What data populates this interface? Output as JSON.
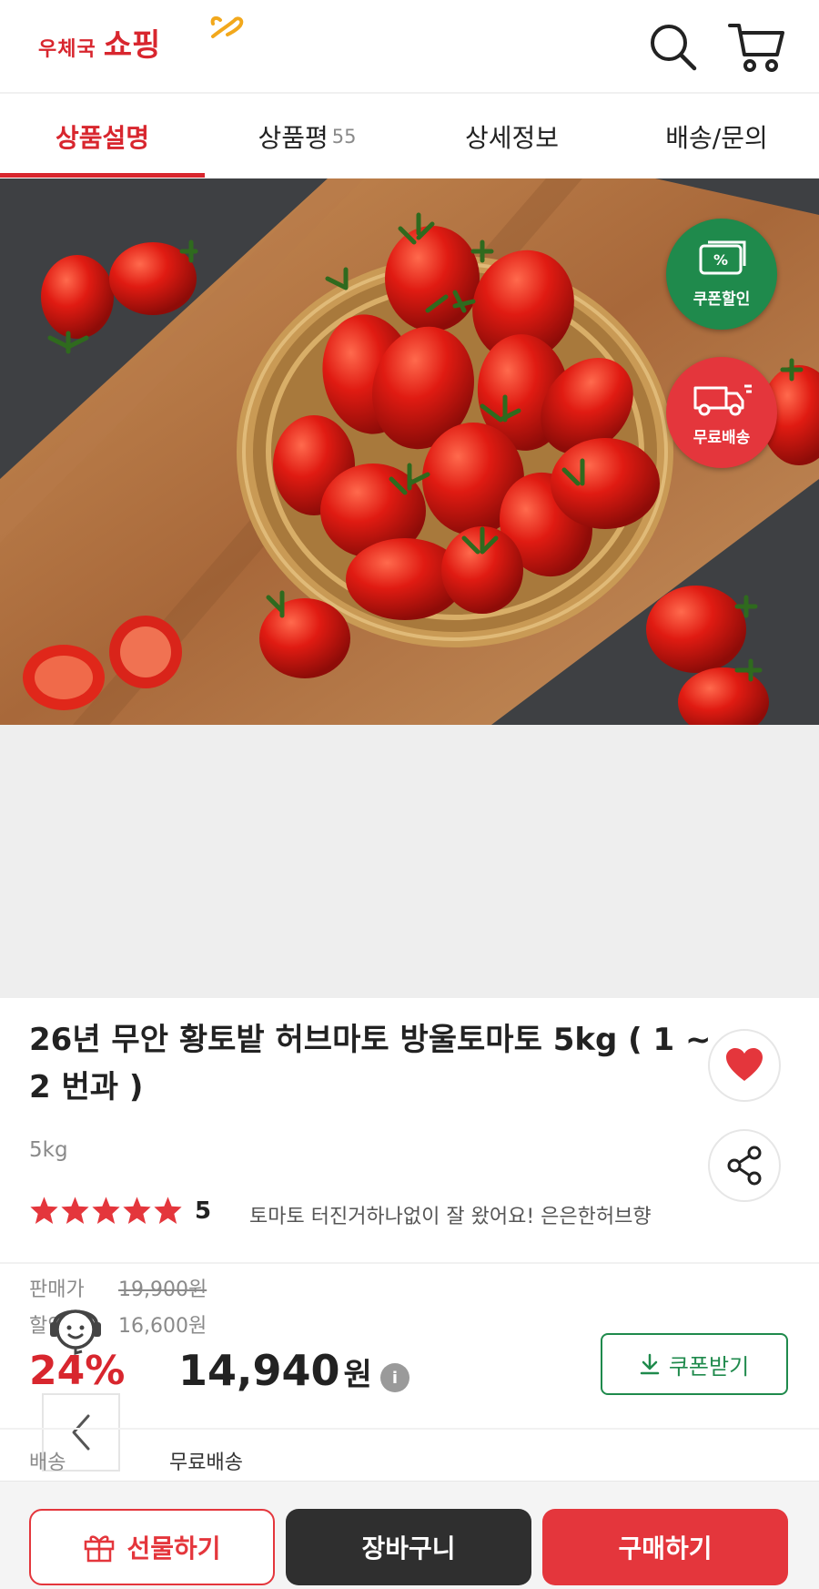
{
  "header": {
    "logo_small": "우체국",
    "logo_big": "쇼핑",
    "icons": [
      "search-icon",
      "cart-icon"
    ]
  },
  "tabs": [
    {
      "label": "상품설명",
      "active": true
    },
    {
      "label": "상품평",
      "count": "55"
    },
    {
      "label": "상세정보"
    },
    {
      "label": "배송/문의"
    }
  ],
  "badges": {
    "coupon": "쿠폰할인",
    "coupon_symbol": "%",
    "shipping": "무료배송"
  },
  "product": {
    "title": "26년 무안 황토밭 허브마토 방울토마토 5kg ( 1 ~ 2 번과 )",
    "option": "5kg",
    "rating": "5",
    "stars_filled": 5,
    "review_snippet": "토마토 터진거하나없이 잘 왔어요! 은은한허브향"
  },
  "price": {
    "original_label": "판매가",
    "original": "19,900원",
    "discount_label": "할인가",
    "discounted": "16,600원",
    "rate": "24%",
    "final": "14,940",
    "final_unit": "원",
    "info_symbol": "i",
    "coupon_button": "쿠폰받기"
  },
  "shipping": {
    "label": "배송",
    "value": "무료배송"
  },
  "bottom_bar": {
    "gift": "선물하기",
    "cart": "장바구니",
    "buy": "구매하기"
  },
  "colors": {
    "brand_red": "#d8262e",
    "coupon_green": "#1f8a4c",
    "dark_button": "#2f2f2f"
  }
}
